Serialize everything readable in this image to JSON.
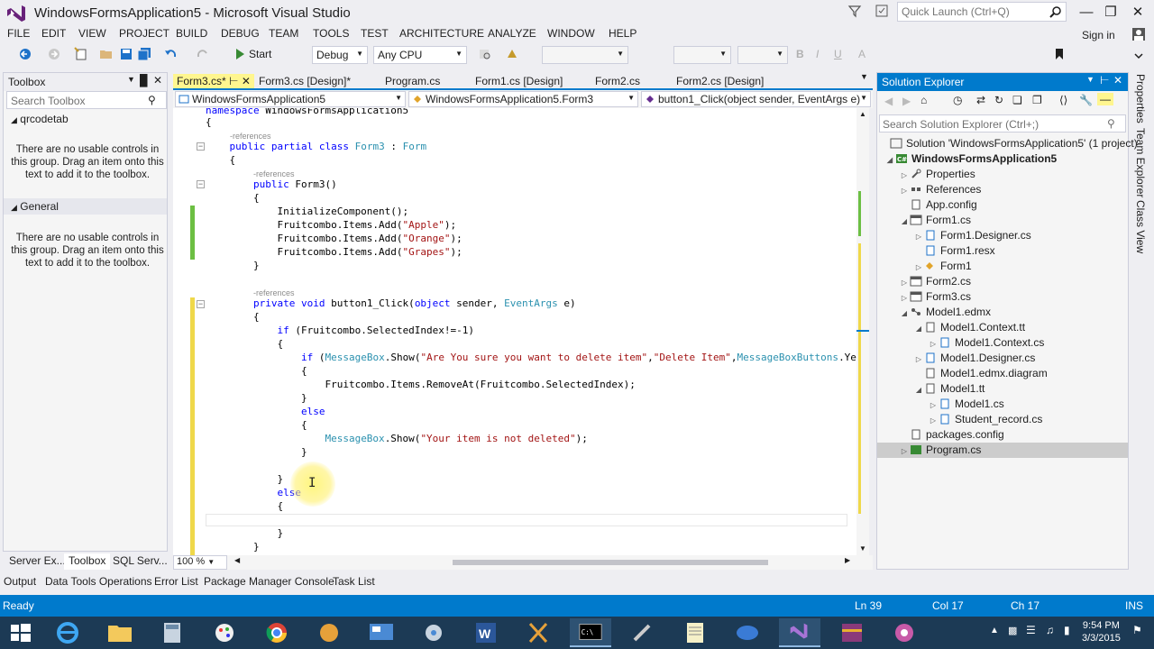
{
  "window": {
    "title": "WindowsFormsApplication5 - Microsoft Visual Studio",
    "quick_launch_placeholder": "Quick Launch (Ctrl+Q)",
    "sign_in": "Sign in"
  },
  "menu": [
    "FILE",
    "EDIT",
    "VIEW",
    "PROJECT",
    "BUILD",
    "DEBUG",
    "TEAM",
    "TOOLS",
    "TEST",
    "ARCHITECTURE",
    "ANALYZE",
    "WINDOW",
    "HELP"
  ],
  "toolbar": {
    "start": "Start",
    "config": "Debug",
    "platform": "Any CPU"
  },
  "toolbox": {
    "title": "Toolbox",
    "search_placeholder": "Search Toolbox",
    "group1": "qrcodetab",
    "group2": "General",
    "empty_msg": "There are no usable controls in this group. Drag an item onto this text to add it to the toolbox.",
    "tabs": [
      "Server Ex...",
      "Toolbox",
      "SQL Serv..."
    ]
  },
  "doc_tabs": [
    "Form3.cs*",
    "Form3.cs [Design]*",
    "Program.cs",
    "Form1.cs [Design]",
    "Form2.cs",
    "Form2.cs [Design]"
  ],
  "nav": {
    "project": "WindowsFormsApplication5",
    "class": "WindowsFormsApplication5.Form3",
    "member": "button1_Click(object sender, EventArgs e)"
  },
  "code": {
    "zoom": "100 %"
  },
  "solution_explorer": {
    "title": "Solution Explorer",
    "search_placeholder": "Search Solution Explorer (Ctrl+;)",
    "items": [
      "Solution 'WindowsFormsApplication5' (1 project)",
      "WindowsFormsApplication5",
      "Properties",
      "References",
      "App.config",
      "Form1.cs",
      "Form1.Designer.cs",
      "Form1.resx",
      "Form1",
      "Form2.cs",
      "Form3.cs",
      "Model1.edmx",
      "Model1.Context.tt",
      "Model1.Context.cs",
      "Model1.Designer.cs",
      "Model1.edmx.diagram",
      "Model1.tt",
      "Model1.cs",
      "Student_record.cs",
      "packages.config",
      "Program.cs"
    ]
  },
  "side_tabs": [
    "Properties",
    "Team Explorer",
    "Class View"
  ],
  "bottom_tabs": [
    "Output",
    "Data Tools Operations",
    "Error List",
    "Package Manager Console",
    "Task List"
  ],
  "status": {
    "ready": "Ready",
    "ln": "Ln 39",
    "col": "Col 17",
    "ch": "Ch 17",
    "ins": "INS"
  },
  "clock": {
    "time": "9:54 PM",
    "date": "3/3/2015"
  }
}
